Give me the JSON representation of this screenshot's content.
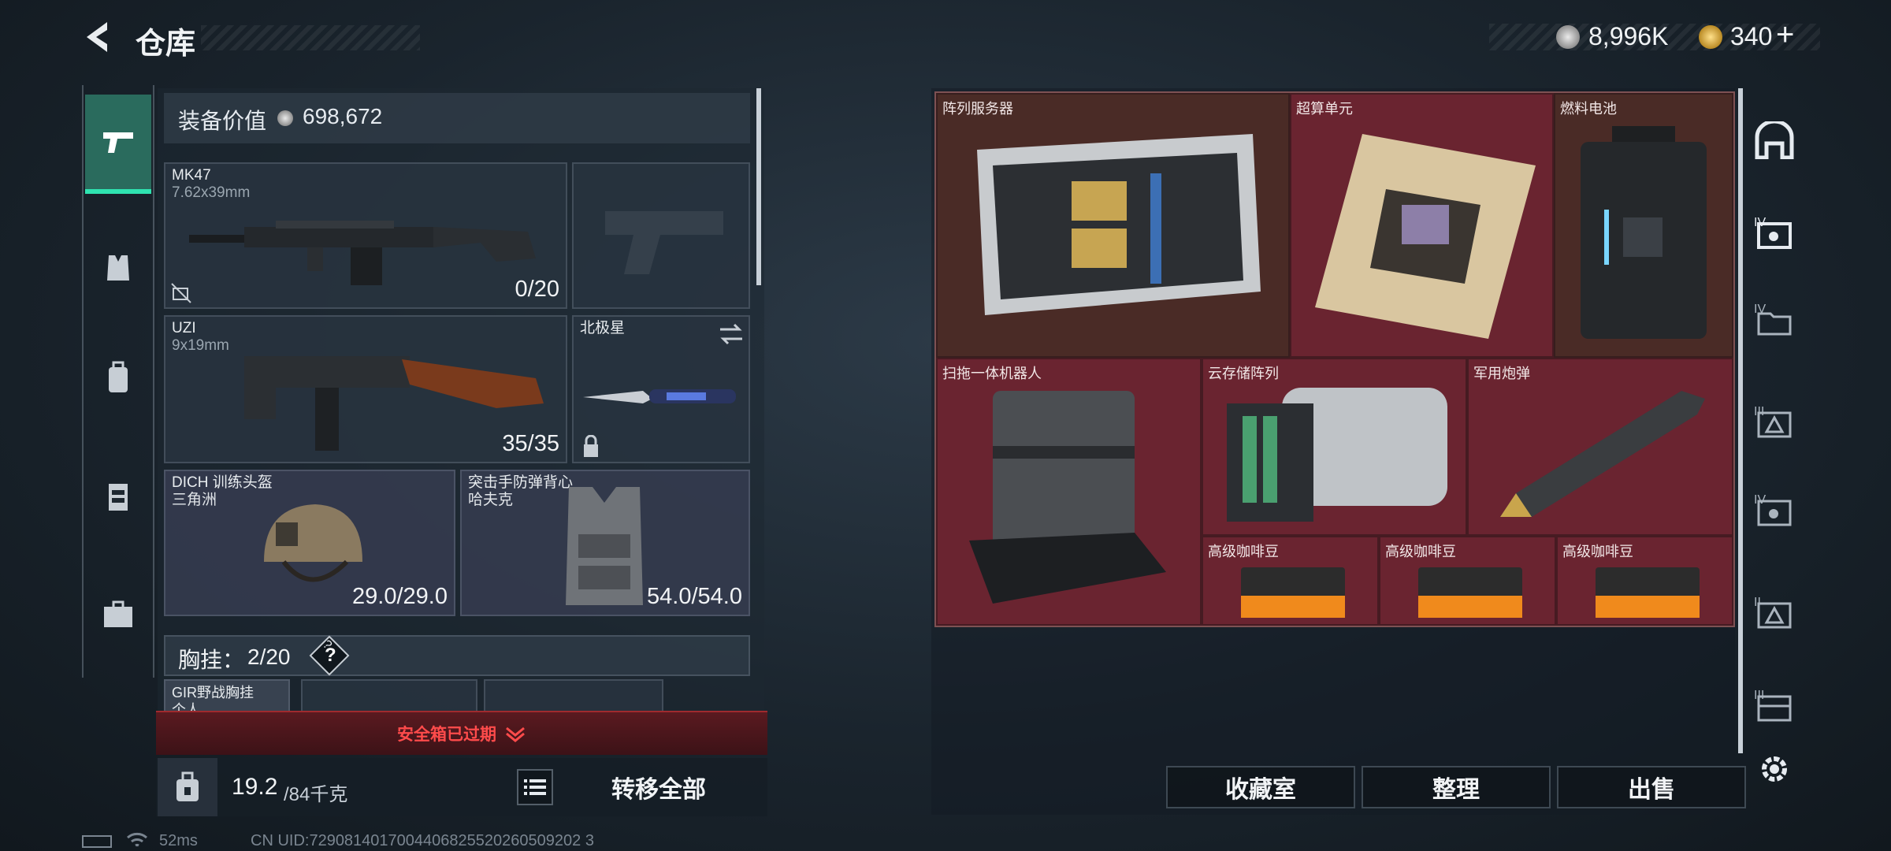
{
  "header": {
    "title": "仓库",
    "currency": "8,996K",
    "premium": "340",
    "plus": "+"
  },
  "left_nav": {
    "items": [
      {
        "icon": "pistol-icon"
      },
      {
        "icon": "armor-icon"
      },
      {
        "icon": "backpack-icon"
      },
      {
        "icon": "rig-icon"
      },
      {
        "icon": "briefcase-icon"
      }
    ]
  },
  "loadout": {
    "value_label": "装备价值",
    "value": "698,672",
    "primary": {
      "name": "MK47",
      "caliber": "7.62x39mm",
      "ammo": "0/20"
    },
    "secondary": {
      "name": "UZI",
      "caliber": "9x19mm",
      "ammo": "35/35"
    },
    "melee": {
      "name": "北极星"
    },
    "helmet": {
      "name": "DICH 训练头盔",
      "brand": "三角洲",
      "durability": "29.0/29.0"
    },
    "armor": {
      "name": "突击手防弹背心",
      "brand": "哈夫克",
      "durability": "54.0/54.0"
    },
    "rig": {
      "label": "胸挂：",
      "capacity": "2/20",
      "help": "?"
    },
    "rig_item": {
      "name": "GIR野战胸挂",
      "sub": "个人..."
    }
  },
  "safe_box": {
    "status": "安全箱已过期"
  },
  "bottom": {
    "weight": "19.2",
    "weight_max": "/84千克",
    "transfer_all": "转移全部"
  },
  "stash": {
    "items": [
      {
        "name": "阵列服务器"
      },
      {
        "name": "超算单元"
      },
      {
        "name": "燃料电池"
      },
      {
        "name": "扫拖一体机器人"
      },
      {
        "name": "云存储阵列"
      },
      {
        "name": "军用炮弹"
      },
      {
        "name": "高级咖啡豆"
      },
      {
        "name": "高级咖啡豆"
      },
      {
        "name": "高级咖啡豆"
      }
    ]
  },
  "actions": {
    "collection": "收藏室",
    "sort": "整理",
    "sell": "出售"
  },
  "right_nav": {
    "tiers": [
      "IV",
      "IV",
      "III",
      "IV",
      "II",
      "III"
    ]
  },
  "status_bar": {
    "ping": "52ms",
    "uid": "CN UID:7290814017004406825520260509202 3"
  },
  "colors": {
    "accent_green": "#2fe3b0",
    "alert_red": "#ff4b4b",
    "stash_red": "#6a2430",
    "stash_brown": "#4a2b26"
  }
}
